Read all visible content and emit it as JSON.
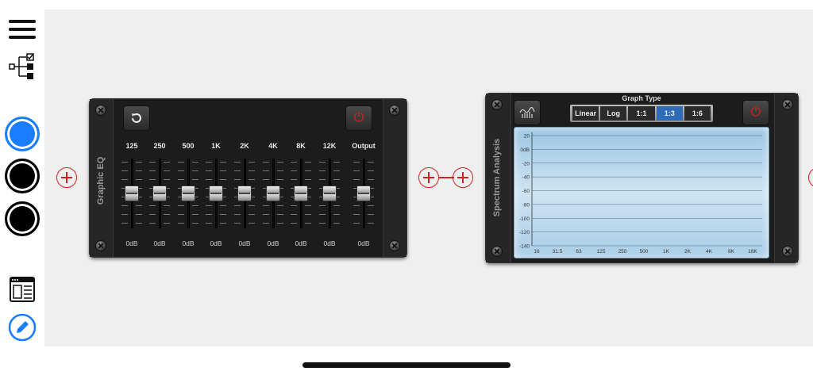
{
  "sidebar": {
    "menu_icon": "hamburger-menu-icon",
    "tree_icon": "signal-tree-icon",
    "slot1_color": "#1a7dff",
    "slot2_color": "#000000",
    "slot3_color": "#000000",
    "layout_icon": "layout-icon",
    "edit_icon": "edit-pencil-icon"
  },
  "graphic_eq": {
    "title": "Graphic EQ",
    "reset_icon": "reset-icon",
    "power_icon": "power-icon",
    "bands": [
      {
        "label": "125",
        "gain": "0dB"
      },
      {
        "label": "250",
        "gain": "0dB"
      },
      {
        "label": "500",
        "gain": "0dB"
      },
      {
        "label": "1K",
        "gain": "0dB"
      },
      {
        "label": "2K",
        "gain": "0dB"
      },
      {
        "label": "4K",
        "gain": "0dB"
      },
      {
        "label": "8K",
        "gain": "0dB"
      },
      {
        "label": "12K",
        "gain": "0dB"
      },
      {
        "label": "Output",
        "gain": "0dB"
      }
    ]
  },
  "spectrum": {
    "title": "Spectrum Analysis",
    "graph_type_title": "Graph Type",
    "graph_types": [
      "Linear",
      "Log",
      "1:1",
      "1:3",
      "1:6"
    ],
    "selected_graph_type": "1:3",
    "y_ticks": [
      "20",
      "0dB",
      "-20",
      "-40",
      "-60",
      "-80",
      "-100",
      "-120",
      "-140"
    ],
    "x_ticks": [
      "16",
      "31.5",
      "63",
      "125",
      "250",
      "500",
      "1K",
      "2K",
      "4K",
      "8K",
      "16K"
    ],
    "accent_color": "#2e6cb8"
  },
  "colors": {
    "connector_red": "#d92020",
    "power_red": "#e0201a"
  }
}
